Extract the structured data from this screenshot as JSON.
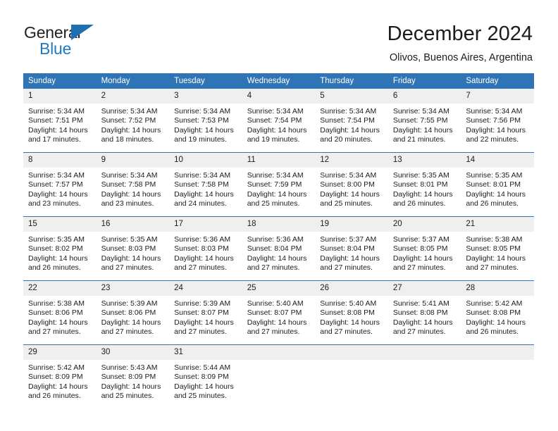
{
  "brand": {
    "word_general": "General",
    "word_blue": "Blue",
    "flag_icon": "triangle-flag-icon",
    "accent_color": "#1f6fb4"
  },
  "header": {
    "title": "December 2024",
    "location": "Olivos, Buenos Aires, Argentina"
  },
  "theme": {
    "header_bg": "#2f74b5",
    "daynum_bg": "#efefef",
    "text_color": "#1c1c1c",
    "row_divider": "#2f74b5"
  },
  "weekday_headers": [
    "Sunday",
    "Monday",
    "Tuesday",
    "Wednesday",
    "Thursday",
    "Friday",
    "Saturday"
  ],
  "labels": {
    "sunrise_prefix": "Sunrise:",
    "sunset_prefix": "Sunset:",
    "daylight_prefix": "Daylight:"
  },
  "weeks": [
    [
      {
        "day": "1",
        "sunrise": "Sunrise: 5:34 AM",
        "sunset": "Sunset: 7:51 PM",
        "daylight_line1": "Daylight: 14 hours",
        "daylight_line2": "and 17 minutes."
      },
      {
        "day": "2",
        "sunrise": "Sunrise: 5:34 AM",
        "sunset": "Sunset: 7:52 PM",
        "daylight_line1": "Daylight: 14 hours",
        "daylight_line2": "and 18 minutes."
      },
      {
        "day": "3",
        "sunrise": "Sunrise: 5:34 AM",
        "sunset": "Sunset: 7:53 PM",
        "daylight_line1": "Daylight: 14 hours",
        "daylight_line2": "and 19 minutes."
      },
      {
        "day": "4",
        "sunrise": "Sunrise: 5:34 AM",
        "sunset": "Sunset: 7:54 PM",
        "daylight_line1": "Daylight: 14 hours",
        "daylight_line2": "and 19 minutes."
      },
      {
        "day": "5",
        "sunrise": "Sunrise: 5:34 AM",
        "sunset": "Sunset: 7:54 PM",
        "daylight_line1": "Daylight: 14 hours",
        "daylight_line2": "and 20 minutes."
      },
      {
        "day": "6",
        "sunrise": "Sunrise: 5:34 AM",
        "sunset": "Sunset: 7:55 PM",
        "daylight_line1": "Daylight: 14 hours",
        "daylight_line2": "and 21 minutes."
      },
      {
        "day": "7",
        "sunrise": "Sunrise: 5:34 AM",
        "sunset": "Sunset: 7:56 PM",
        "daylight_line1": "Daylight: 14 hours",
        "daylight_line2": "and 22 minutes."
      }
    ],
    [
      {
        "day": "8",
        "sunrise": "Sunrise: 5:34 AM",
        "sunset": "Sunset: 7:57 PM",
        "daylight_line1": "Daylight: 14 hours",
        "daylight_line2": "and 23 minutes."
      },
      {
        "day": "9",
        "sunrise": "Sunrise: 5:34 AM",
        "sunset": "Sunset: 7:58 PM",
        "daylight_line1": "Daylight: 14 hours",
        "daylight_line2": "and 23 minutes."
      },
      {
        "day": "10",
        "sunrise": "Sunrise: 5:34 AM",
        "sunset": "Sunset: 7:58 PM",
        "daylight_line1": "Daylight: 14 hours",
        "daylight_line2": "and 24 minutes."
      },
      {
        "day": "11",
        "sunrise": "Sunrise: 5:34 AM",
        "sunset": "Sunset: 7:59 PM",
        "daylight_line1": "Daylight: 14 hours",
        "daylight_line2": "and 25 minutes."
      },
      {
        "day": "12",
        "sunrise": "Sunrise: 5:34 AM",
        "sunset": "Sunset: 8:00 PM",
        "daylight_line1": "Daylight: 14 hours",
        "daylight_line2": "and 25 minutes."
      },
      {
        "day": "13",
        "sunrise": "Sunrise: 5:35 AM",
        "sunset": "Sunset: 8:01 PM",
        "daylight_line1": "Daylight: 14 hours",
        "daylight_line2": "and 26 minutes."
      },
      {
        "day": "14",
        "sunrise": "Sunrise: 5:35 AM",
        "sunset": "Sunset: 8:01 PM",
        "daylight_line1": "Daylight: 14 hours",
        "daylight_line2": "and 26 minutes."
      }
    ],
    [
      {
        "day": "15",
        "sunrise": "Sunrise: 5:35 AM",
        "sunset": "Sunset: 8:02 PM",
        "daylight_line1": "Daylight: 14 hours",
        "daylight_line2": "and 26 minutes."
      },
      {
        "day": "16",
        "sunrise": "Sunrise: 5:35 AM",
        "sunset": "Sunset: 8:03 PM",
        "daylight_line1": "Daylight: 14 hours",
        "daylight_line2": "and 27 minutes."
      },
      {
        "day": "17",
        "sunrise": "Sunrise: 5:36 AM",
        "sunset": "Sunset: 8:03 PM",
        "daylight_line1": "Daylight: 14 hours",
        "daylight_line2": "and 27 minutes."
      },
      {
        "day": "18",
        "sunrise": "Sunrise: 5:36 AM",
        "sunset": "Sunset: 8:04 PM",
        "daylight_line1": "Daylight: 14 hours",
        "daylight_line2": "and 27 minutes."
      },
      {
        "day": "19",
        "sunrise": "Sunrise: 5:37 AM",
        "sunset": "Sunset: 8:04 PM",
        "daylight_line1": "Daylight: 14 hours",
        "daylight_line2": "and 27 minutes."
      },
      {
        "day": "20",
        "sunrise": "Sunrise: 5:37 AM",
        "sunset": "Sunset: 8:05 PM",
        "daylight_line1": "Daylight: 14 hours",
        "daylight_line2": "and 27 minutes."
      },
      {
        "day": "21",
        "sunrise": "Sunrise: 5:38 AM",
        "sunset": "Sunset: 8:05 PM",
        "daylight_line1": "Daylight: 14 hours",
        "daylight_line2": "and 27 minutes."
      }
    ],
    [
      {
        "day": "22",
        "sunrise": "Sunrise: 5:38 AM",
        "sunset": "Sunset: 8:06 PM",
        "daylight_line1": "Daylight: 14 hours",
        "daylight_line2": "and 27 minutes."
      },
      {
        "day": "23",
        "sunrise": "Sunrise: 5:39 AM",
        "sunset": "Sunset: 8:06 PM",
        "daylight_line1": "Daylight: 14 hours",
        "daylight_line2": "and 27 minutes."
      },
      {
        "day": "24",
        "sunrise": "Sunrise: 5:39 AM",
        "sunset": "Sunset: 8:07 PM",
        "daylight_line1": "Daylight: 14 hours",
        "daylight_line2": "and 27 minutes."
      },
      {
        "day": "25",
        "sunrise": "Sunrise: 5:40 AM",
        "sunset": "Sunset: 8:07 PM",
        "daylight_line1": "Daylight: 14 hours",
        "daylight_line2": "and 27 minutes."
      },
      {
        "day": "26",
        "sunrise": "Sunrise: 5:40 AM",
        "sunset": "Sunset: 8:08 PM",
        "daylight_line1": "Daylight: 14 hours",
        "daylight_line2": "and 27 minutes."
      },
      {
        "day": "27",
        "sunrise": "Sunrise: 5:41 AM",
        "sunset": "Sunset: 8:08 PM",
        "daylight_line1": "Daylight: 14 hours",
        "daylight_line2": "and 27 minutes."
      },
      {
        "day": "28",
        "sunrise": "Sunrise: 5:42 AM",
        "sunset": "Sunset: 8:08 PM",
        "daylight_line1": "Daylight: 14 hours",
        "daylight_line2": "and 26 minutes."
      }
    ],
    [
      {
        "day": "29",
        "sunrise": "Sunrise: 5:42 AM",
        "sunset": "Sunset: 8:09 PM",
        "daylight_line1": "Daylight: 14 hours",
        "daylight_line2": "and 26 minutes."
      },
      {
        "day": "30",
        "sunrise": "Sunrise: 5:43 AM",
        "sunset": "Sunset: 8:09 PM",
        "daylight_line1": "Daylight: 14 hours",
        "daylight_line2": "and 25 minutes."
      },
      {
        "day": "31",
        "sunrise": "Sunrise: 5:44 AM",
        "sunset": "Sunset: 8:09 PM",
        "daylight_line1": "Daylight: 14 hours",
        "daylight_line2": "and 25 minutes."
      },
      {
        "day": "",
        "sunrise": "",
        "sunset": "",
        "daylight_line1": "",
        "daylight_line2": ""
      },
      {
        "day": "",
        "sunrise": "",
        "sunset": "",
        "daylight_line1": "",
        "daylight_line2": ""
      },
      {
        "day": "",
        "sunrise": "",
        "sunset": "",
        "daylight_line1": "",
        "daylight_line2": ""
      },
      {
        "day": "",
        "sunrise": "",
        "sunset": "",
        "daylight_line1": "",
        "daylight_line2": ""
      }
    ]
  ]
}
